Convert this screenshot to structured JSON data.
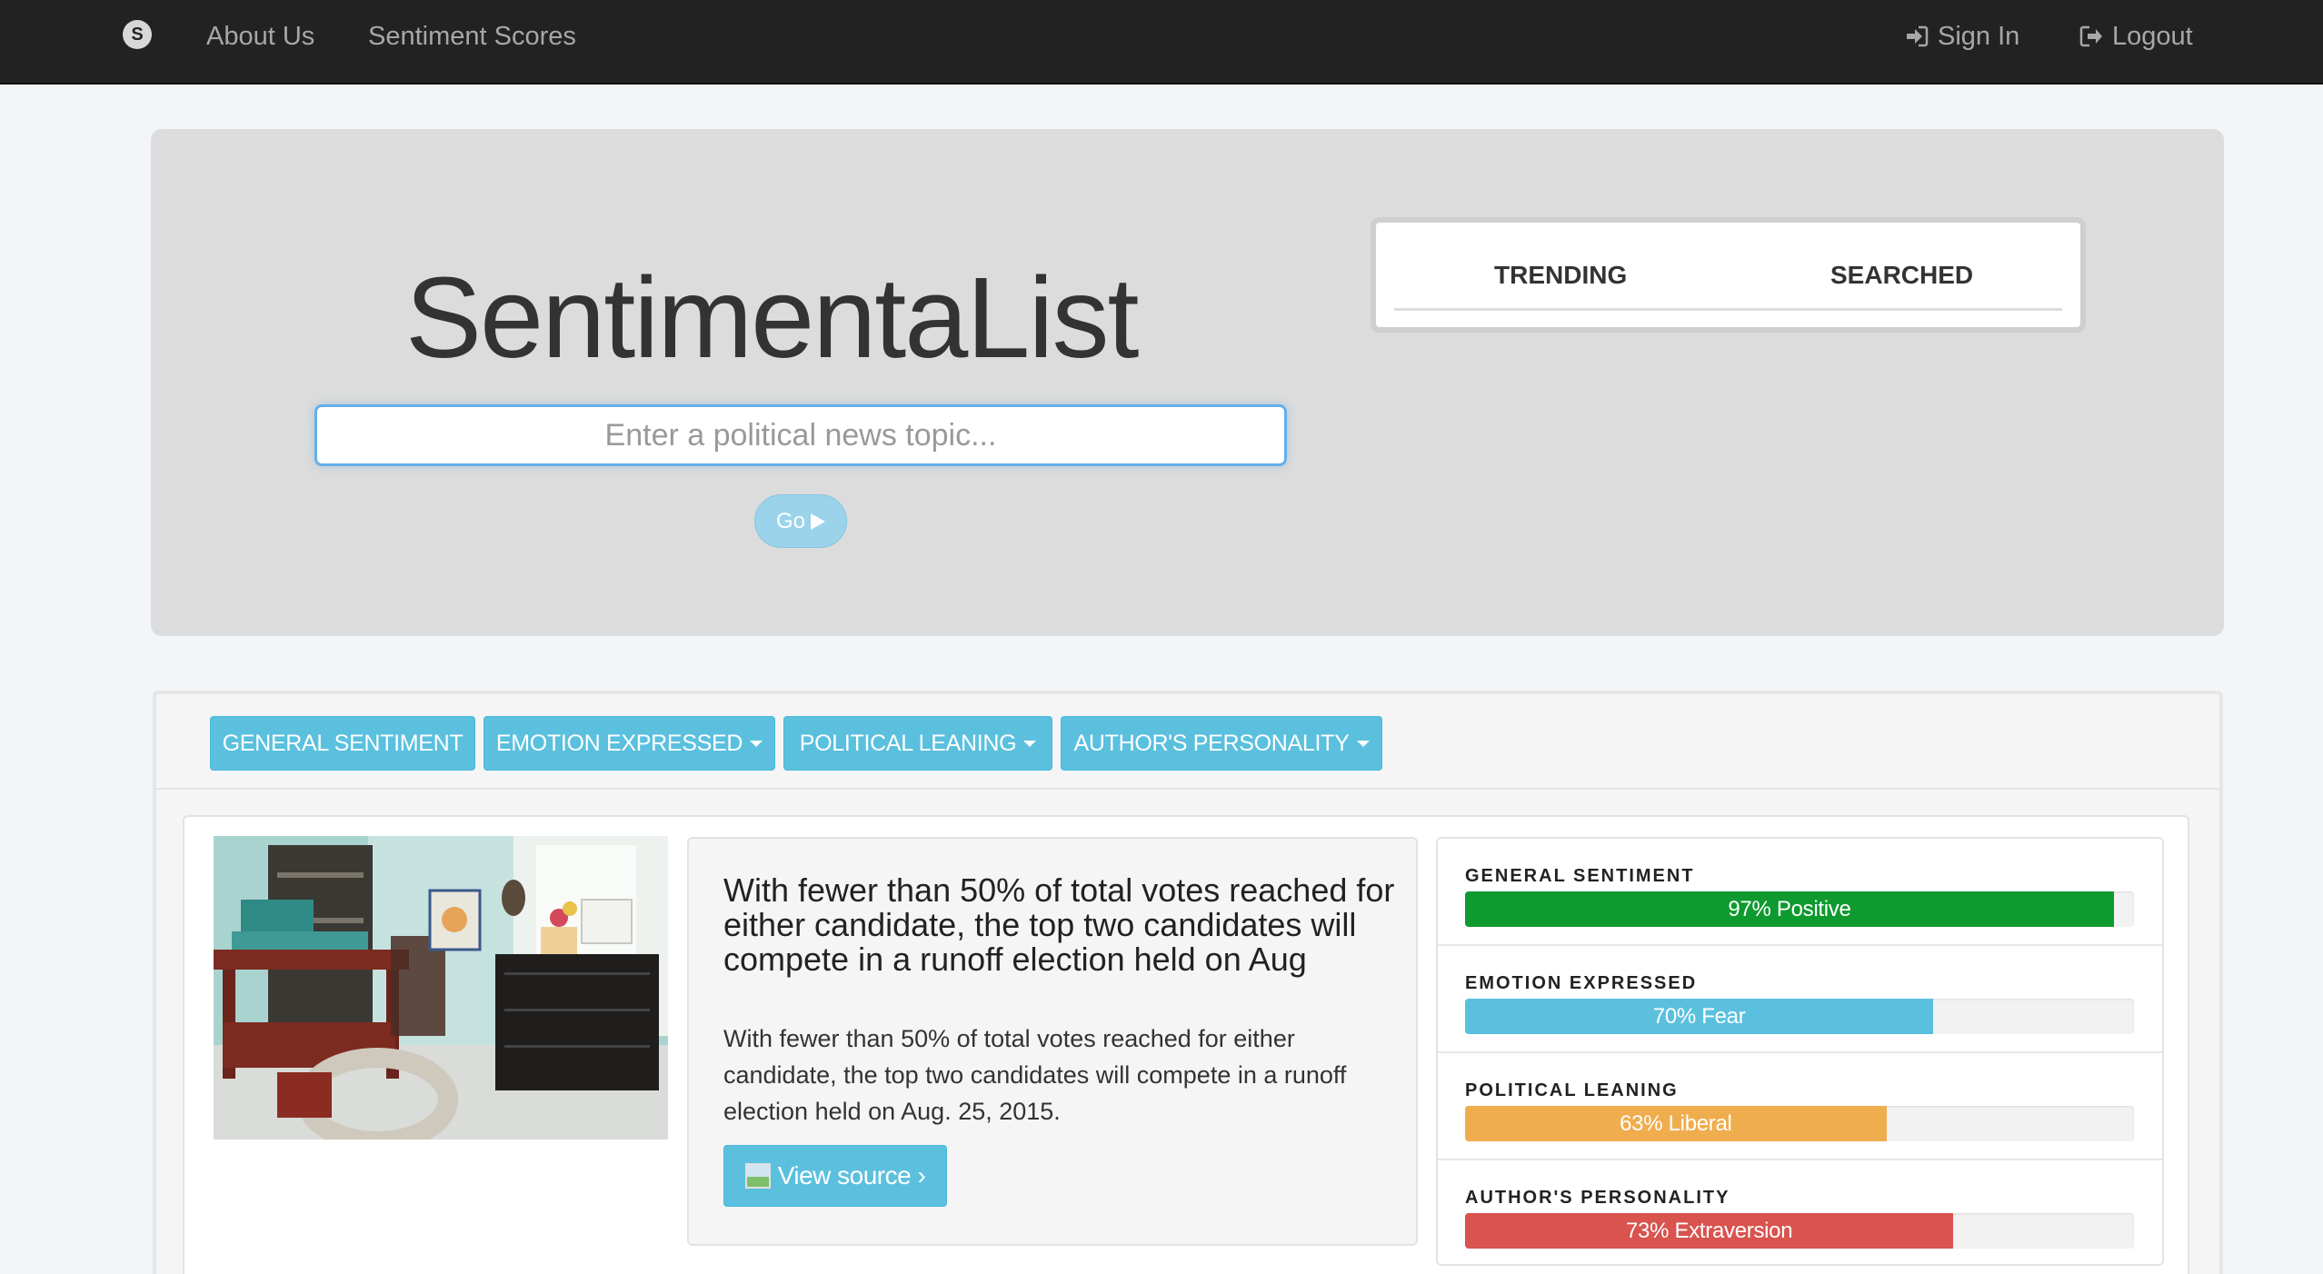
{
  "navbar": {
    "logo_letter": "S",
    "links": [
      "About Us",
      "Sentiment Scores"
    ],
    "sign_in": "Sign In",
    "logout": "Logout"
  },
  "hero": {
    "title": "SentimentaList",
    "search_placeholder": "Enter a political news topic...",
    "go_label": "Go",
    "tabs": [
      "TRENDING",
      "SEARCHED"
    ]
  },
  "filters": [
    {
      "label": "GENERAL SENTIMENT",
      "dropdown": false
    },
    {
      "label": "EMOTION EXPRESSED",
      "dropdown": true
    },
    {
      "label": "POLITICAL LEANING",
      "dropdown": true
    },
    {
      "label": "AUTHOR'S PERSONALITY",
      "dropdown": true
    }
  ],
  "article": {
    "title": "With fewer than 50% of total votes reached for either candidate, the top two candidates will compete in a runoff election held on Aug",
    "body": "With fewer than 50% of total votes reached for either candidate, the top two candidates will compete in a runoff election held on Aug. 25, 2015.",
    "view_source": "View source ›"
  },
  "metrics": [
    {
      "label": "GENERAL SENTIMENT",
      "text": "97% Positive",
      "percent": 97,
      "color": "#0e9a2f"
    },
    {
      "label": "EMOTION EXPRESSED",
      "text": "70% Fear",
      "percent": 70,
      "color": "#5bc0de"
    },
    {
      "label": "POLITICAL LEANING",
      "text": "63% Liberal",
      "percent": 63,
      "color": "#f0ad4e"
    },
    {
      "label": "AUTHOR'S PERSONALITY",
      "text": "73% Extraversion",
      "percent": 73,
      "color": "#d9534f"
    }
  ]
}
